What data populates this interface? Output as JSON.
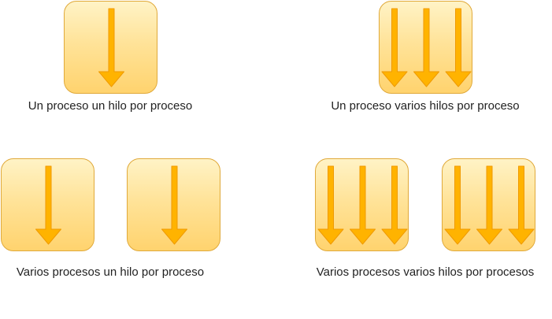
{
  "captions": {
    "single_process_single_thread": "Un proceso un hilo por proceso",
    "single_process_multi_thread": "Un proceso varios hilos por proceso",
    "multi_process_single_thread": "Varios procesos un hilo por proceso",
    "multi_process_multi_thread": "Varios procesos varios hilos por procesos"
  },
  "colors": {
    "process_fill_top": "#fff3c6",
    "process_fill_bottom": "#ffd36e",
    "process_border": "#e0a93a",
    "thread_arrow": "#ffb300",
    "thread_arrow_stroke": "#f09a00"
  }
}
